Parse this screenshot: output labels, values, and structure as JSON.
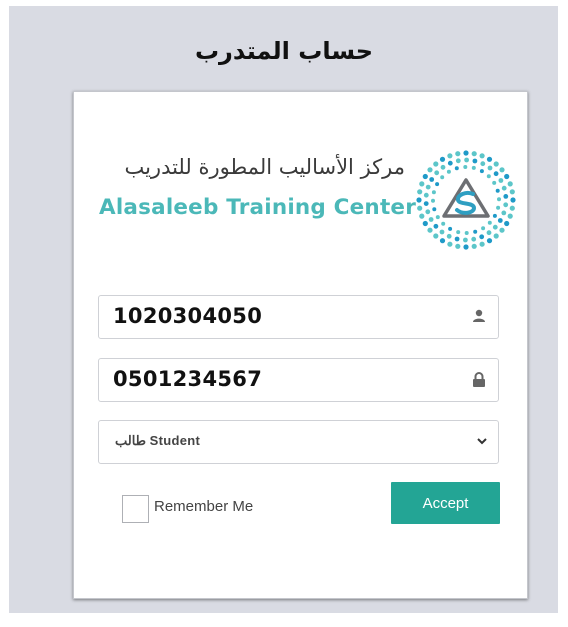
{
  "page": {
    "title": "حساب المتدرب"
  },
  "logo": {
    "arabic_name": "مركز الأساليب المطورة للتدريب",
    "english_name": "Alasaleeb Training Center",
    "mark_letter": "S"
  },
  "form": {
    "id_value": "1020304050",
    "password_value": "0501234567",
    "account_type_selected": "طالب Student",
    "remember_label": "Remember Me",
    "remember_checked": false,
    "accept_label": "Accept"
  },
  "colors": {
    "accent": "#23a595",
    "logo_teal": "#4bb8b8",
    "background": "#d9dbe3"
  },
  "icons": {
    "id_field": "user-icon",
    "password_field": "lock-icon",
    "select": "chevron-down-icon"
  }
}
